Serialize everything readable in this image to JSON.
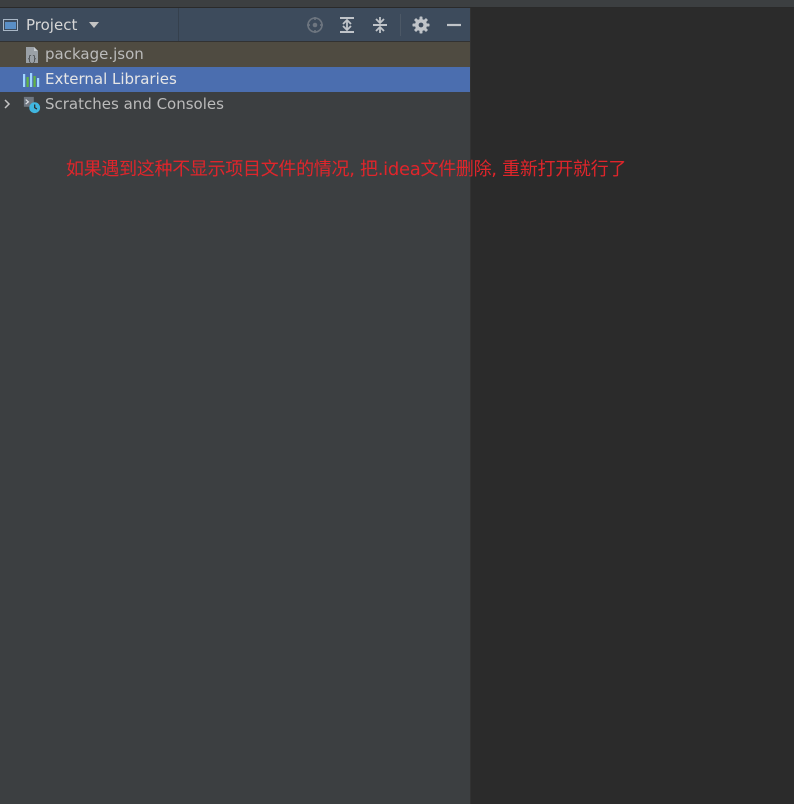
{
  "panel": {
    "title": "Project",
    "toolbar_icons": [
      "crosshair-icon",
      "expand-all-icon",
      "collapse-all-icon",
      "gear-icon",
      "minimize-icon"
    ]
  },
  "tree": {
    "items": [
      {
        "label": "package.json",
        "icon": "json-file-icon",
        "selected": false
      },
      {
        "label": "External Libraries",
        "icon": "library-icon",
        "selected": true
      },
      {
        "label": "Scratches and Consoles",
        "icon": "scratches-icon",
        "collapsed": true
      }
    ]
  },
  "annotation": {
    "text": "如果遇到这种不显示项目文件的情况, 把.idea文件删除, 重新打开就行了",
    "color": "#e0252b"
  },
  "colors": {
    "header_bg": "#3d4b5c",
    "panel_bg": "#3c3f41",
    "editor_bg": "#2b2b2b",
    "selection": "#4b6eaf"
  }
}
